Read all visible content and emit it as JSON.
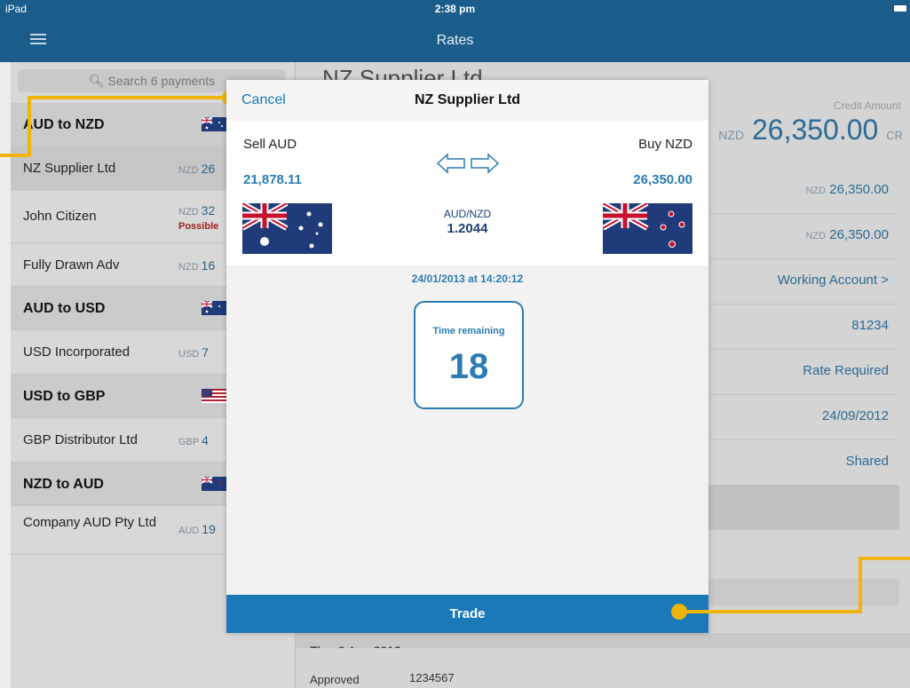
{
  "status": {
    "device": "iPad",
    "time": "2:38 pm"
  },
  "nav": {
    "title": "Rates",
    "menu_icon": "hamburger-menu-icon"
  },
  "search": {
    "placeholder": "Search 6 payments"
  },
  "groups": [
    {
      "title": "AUD to NZD",
      "flag": "australia-flag-icon",
      "items": [
        {
          "name": "NZ Supplier Ltd",
          "ccy": "NZD",
          "amount": "26"
        },
        {
          "name": "John Citizen",
          "ccy": "NZD",
          "amount": "32",
          "warning": "Possible"
        },
        {
          "name": "Fully Drawn Adv",
          "ccy": "NZD",
          "amount": "16"
        }
      ]
    },
    {
      "title": "AUD to USD",
      "flag": "australia-flag-icon",
      "items": [
        {
          "name": "USD Incorporated",
          "ccy": "USD",
          "amount": "7"
        }
      ]
    },
    {
      "title": "USD to GBP",
      "flag": "usa-flag-icon",
      "items": [
        {
          "name": "GBP Distributor Ltd",
          "ccy": "GBP",
          "amount": "4"
        }
      ]
    },
    {
      "title": "NZD to AUD",
      "flag": "new-zealand-flag-icon",
      "items": [
        {
          "name": "Company AUD Pty Ltd",
          "ccy": "AUD",
          "amount": "19"
        }
      ]
    }
  ],
  "details": {
    "title": "NZ Supplier Ltd",
    "credit_label": "Credit Amount",
    "credit_ccy": "NZD",
    "credit_amount": "26,350.00",
    "credit_suffix": "CR",
    "rows": [
      {
        "ccy": "NZD",
        "value": "26,350.00"
      },
      {
        "ccy": "NZD",
        "value": "26,350.00"
      },
      {
        "value": "Working Account  >"
      },
      {
        "value": "81234"
      },
      {
        "value": "Rate Required"
      },
      {
        "value": "24/09/2012"
      },
      {
        "value": "Shared"
      }
    ],
    "day_header": "Thu, 9 Aug 2012",
    "detail_status": "Approved",
    "detail_ref": "1234567"
  },
  "modal": {
    "cancel_label": "Cancel",
    "title": "NZ Supplier Ltd",
    "sell_label": "Sell AUD",
    "buy_label": "Buy NZD",
    "sell_amount": "21,878.11",
    "buy_amount": "26,350.00",
    "pair": "AUD/NZD",
    "rate": "1.2044",
    "sell_flag": "australia-flag-icon",
    "buy_flag": "new-zealand-flag-icon",
    "swap_icon": "swap-arrows-icon",
    "quote_time": "24/01/2013 at 14:20:12",
    "timer_label": "Time remaining",
    "timer_value": "18",
    "trade_label": "Trade"
  },
  "colors": {
    "navbar": "#1a5d8a",
    "accent": "#1c79b8",
    "callout": "#f1b40a",
    "warning": "#a0211b"
  }
}
